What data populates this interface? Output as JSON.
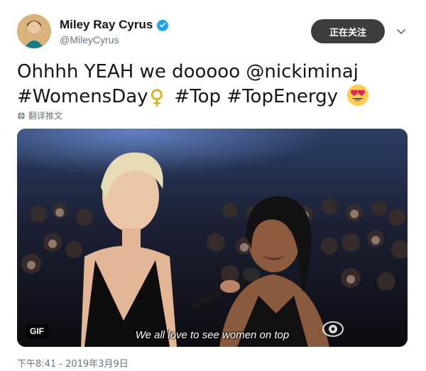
{
  "author": {
    "display_name": "Miley Ray Cyrus",
    "handle": "@MileyCyrus",
    "verified": true
  },
  "follow_button": {
    "label": "正在关注"
  },
  "tweet": {
    "line1": "Ohhhh YEAH we dooooo @nickiminaj",
    "line2_part1": "#WomensDay",
    "line2_part2": "#Top #TopEnergy",
    "emoji_female_sign": "♀",
    "emoji_heart_eyes": "heart-eyes-face"
  },
  "translate_link": {
    "label": "翻译推文"
  },
  "media": {
    "badge": "GIF",
    "caption": "We all love to see women on top",
    "network_logo": "cbs-eye-logo"
  },
  "timestamp": "下午8:41 - 2019年3月9日",
  "colors": {
    "verified": "#1da1f2",
    "follow_button_bg": "#3d3d3d",
    "secondary_text": "#657786",
    "female_sign": "#e5a400"
  }
}
